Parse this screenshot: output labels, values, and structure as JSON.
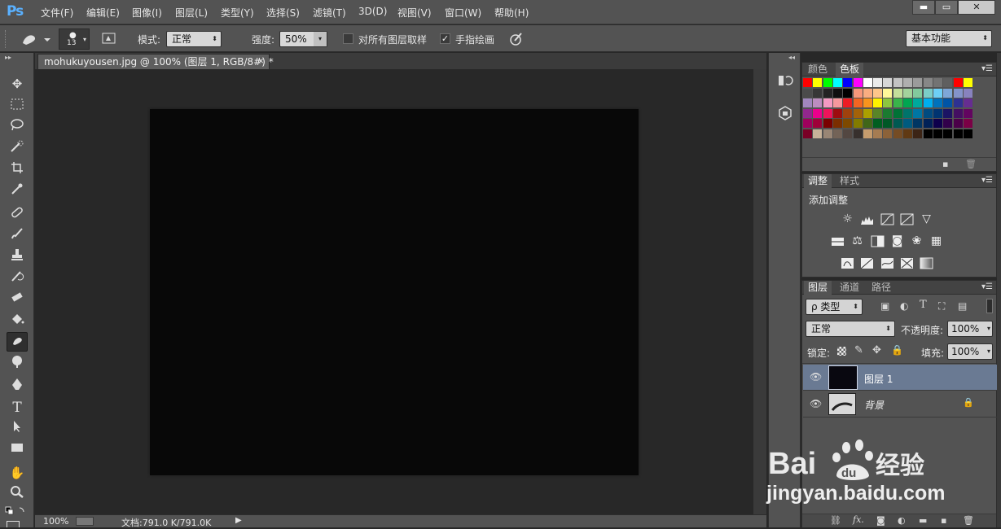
{
  "app": {
    "logo": "Ps"
  },
  "menu": [
    "文件(F)",
    "编辑(E)",
    "图像(I)",
    "图层(L)",
    "类型(Y)",
    "选择(S)",
    "滤镜(T)",
    "3D(D)",
    "视图(V)",
    "窗口(W)",
    "帮助(H)"
  ],
  "window_controls": {
    "minimize": "▬",
    "restore": "▭",
    "close": "✕"
  },
  "options": {
    "brush_size": "13",
    "mode_label": "模式:",
    "mode_value": "正常",
    "strength_label": "强度:",
    "strength_value": "50%",
    "sample_all_label": "对所有图层取样",
    "sample_all_checked": false,
    "finger_paint_label": "手指绘画",
    "finger_paint_checked": true,
    "workspace": "基本功能"
  },
  "document": {
    "tab_title": "mohukuyousen.jpg @ 100% (图层 1, RGB/8#) *",
    "close": "✕",
    "canvas_color": "#080808"
  },
  "status": {
    "zoom": "100%",
    "doc_info": "文档:791.0 K/791.0K"
  },
  "tools": [
    "move",
    "marquee",
    "lasso",
    "quick-select",
    "crop",
    "eyedropper",
    "healing",
    "brush",
    "stamp",
    "history-brush",
    "eraser",
    "paint-bucket",
    "smudge",
    "dodge",
    "pen",
    "type",
    "path-select",
    "shape",
    "hand",
    "zoom"
  ],
  "swatches_panel": {
    "tabs": [
      "颜色",
      "色板"
    ],
    "active_tab": "色板",
    "colors": [
      [
        "#ff0000",
        "#ffff00",
        "#00ff00",
        "#00ffff",
        "#0000ff",
        "#ff00ff",
        "#ffffff",
        "#ebebeb",
        "#d7d7d7",
        "#c3c3c3",
        "#afafaf",
        "#9b9b9b",
        "#878787",
        "#737373",
        "#5f5f5f",
        "#ff0000",
        "#ffff00"
      ],
      [
        "#4b4b4b",
        "#373737",
        "#232323",
        "#0f0f0f",
        "#000000",
        "#f7977a",
        "#f9ad81",
        "#fdc68a",
        "#fff799",
        "#c4df9b",
        "#a3d39c",
        "#82ca9d",
        "#7bcdc8",
        "#6ecff6",
        "#7ea7d8",
        "#8493ca",
        "#8882be"
      ],
      [
        "#a187be",
        "#bc8dbf",
        "#f49ac2",
        "#f6989d",
        "#ed1c24",
        "#f26522",
        "#f7941d",
        "#fff200",
        "#8dc63f",
        "#39b54a",
        "#00a651",
        "#00a99d",
        "#00aeef",
        "#0072bc",
        "#0054a6",
        "#2e3192",
        "#662d91"
      ],
      [
        "#92278f",
        "#ec008c",
        "#ed145b",
        "#9e0b0f",
        "#a0410d",
        "#a36209",
        "#aba000",
        "#598527",
        "#1a7b30",
        "#007236",
        "#00746b",
        "#0076a3",
        "#004b80",
        "#003471",
        "#1b1464",
        "#440e62",
        "#630460"
      ],
      [
        "#9e005d",
        "#9e0039",
        "#790000",
        "#7b2e00",
        "#7d4900",
        "#827b00",
        "#406618",
        "#005e20",
        "#005826",
        "#005952",
        "#005b7f",
        "#003663",
        "#002157",
        "#0d004c",
        "#32004b",
        "#4b0049",
        "#7b0046"
      ],
      [
        "#7a0026",
        "#c7b299",
        "#998675",
        "#736357",
        "#534741",
        "#37302d",
        "#c69c6d",
        "#a67c52",
        "#8c6239",
        "#754c24",
        "#603913",
        "#3c2415",
        "#000000",
        "#000000",
        "#000000",
        "#000000",
        "#000000"
      ]
    ]
  },
  "adjustments_panel": {
    "tabs": [
      "调整",
      "样式"
    ],
    "active_tab": "调整",
    "title": "添加调整"
  },
  "layers_panel": {
    "tabs": [
      "图层",
      "通道",
      "路径"
    ],
    "active_tab": "图层",
    "filter_label": "ρ 类型",
    "blend_mode": "正常",
    "opacity_label": "不透明度:",
    "opacity_value": "100%",
    "lock_label": "锁定:",
    "fill_label": "填充:",
    "fill_value": "100%",
    "layers": [
      {
        "name": "图层 1",
        "selected": true
      },
      {
        "name": "背景",
        "selected": false,
        "locked": true
      }
    ]
  },
  "watermark": {
    "brand": "Bai du 经验",
    "url": "jingyan.baidu.com"
  }
}
